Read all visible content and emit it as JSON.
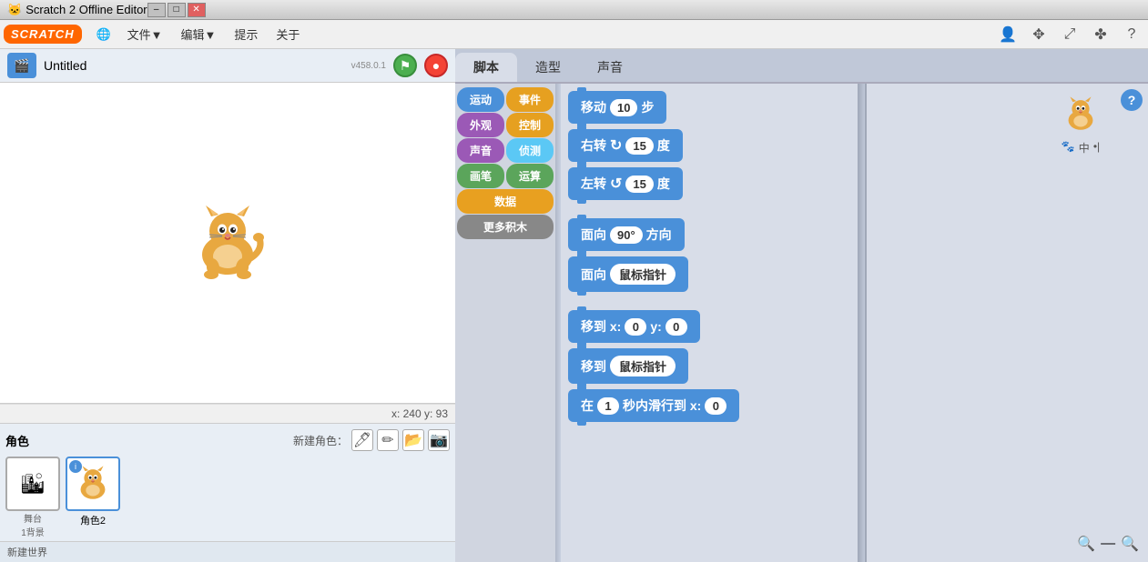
{
  "titlebar": {
    "icon": "🐱",
    "title": "Scratch 2 Offline Editor",
    "min_label": "–",
    "max_label": "□",
    "close_label": "✕"
  },
  "menubar": {
    "logo": "SCRATCH",
    "globe_icon": "🌐",
    "file_label": "文件▼",
    "edit_label": "编辑▼",
    "tips_label": "提示",
    "help_label": "关于",
    "toolbar_icons": [
      "👤",
      "✥",
      "⤢",
      "✤",
      "?"
    ]
  },
  "stage": {
    "title": "Untitled",
    "version": "v458.0.1",
    "flag_icon": "⚑",
    "stop_icon": "●",
    "coords": "x: 240  y: 93"
  },
  "tabs": {
    "script_label": "脚本",
    "costume_label": "造型",
    "sound_label": "声音"
  },
  "categories": [
    {
      "id": "motion",
      "label": "运动",
      "class": "cat-motion"
    },
    {
      "id": "event",
      "label": "事件",
      "class": "cat-event"
    },
    {
      "id": "looks",
      "label": "外观",
      "class": "cat-looks"
    },
    {
      "id": "control",
      "label": "控制",
      "class": "cat-control"
    },
    {
      "id": "sound",
      "label": "声音",
      "class": "cat-sound"
    },
    {
      "id": "sense",
      "label": "侦测",
      "class": "cat-sense"
    },
    {
      "id": "pen",
      "label": "画笔",
      "class": "cat-pen"
    },
    {
      "id": "operator",
      "label": "运算",
      "class": "cat-operator"
    },
    {
      "id": "data",
      "label": "数据",
      "class": "cat-data"
    },
    {
      "id": "more",
      "label": "更多积木",
      "class": "cat-more"
    }
  ],
  "blocks": [
    {
      "id": "move",
      "text_before": "移动",
      "input": "10",
      "text_after": "步"
    },
    {
      "id": "turn_right",
      "text_before": "右转",
      "symbol": "↻",
      "input": "15",
      "text_after": "度"
    },
    {
      "id": "turn_left",
      "text_before": "左转",
      "symbol": "↺",
      "input": "15",
      "text_after": "度"
    },
    {
      "id": "face_direction",
      "text_before": "面向",
      "input": "90°",
      "text_after": "方向"
    },
    {
      "id": "face_mouse",
      "text_before": "面向",
      "input_oval": "鼠标指针"
    },
    {
      "id": "goto_xy",
      "text_before": "移到 x:",
      "input1": "0",
      "text_mid": "y:",
      "input2": "0"
    },
    {
      "id": "goto_mouse",
      "text_before": "移到",
      "input_oval": "鼠标指针"
    },
    {
      "id": "glide",
      "text_before": "在",
      "input": "1",
      "text_mid": "秒内滑行到 x:",
      "input2": "0"
    }
  ],
  "sprites": {
    "label": "角色",
    "new_label": "新建角色：",
    "new_btns": [
      "🖊",
      "✏",
      "📂",
      "📷"
    ],
    "stage_name": "舞台",
    "stage_info": "1背景",
    "sprite_name": "角色2"
  },
  "bottom": {
    "text": "新建世界"
  },
  "sprite_panel_right": {
    "cat_icon": "🐱",
    "label1": "中",
    "label2": "•|"
  }
}
